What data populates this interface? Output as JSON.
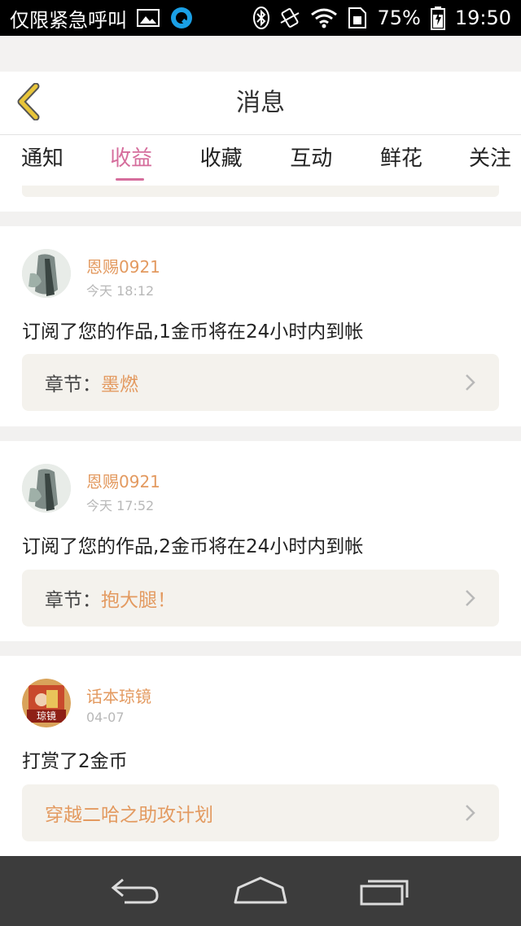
{
  "status_bar": {
    "carrier": "仅限紧急呼叫",
    "battery": "75%",
    "time": "19:50",
    "icons": [
      "image-icon",
      "qq-icon",
      "bluetooth-icon",
      "vibrate-icon",
      "wifi-icon",
      "sim-icon",
      "battery-icon"
    ]
  },
  "header": {
    "title": "消息",
    "back_icon": "chevron-left-icon"
  },
  "tabs": [
    {
      "label": "通知"
    },
    {
      "label": "收益",
      "active": true
    },
    {
      "label": "收藏"
    },
    {
      "label": "互动"
    },
    {
      "label": "鲜花"
    },
    {
      "label": "关注"
    }
  ],
  "messages": [
    {
      "username": "恩赐0921",
      "time": "今天 18:12",
      "text": "订阅了您的作品,1金币将在24小时内到帐",
      "ref_label": "章节：",
      "ref_title": "墨燃"
    },
    {
      "username": "恩赐0921",
      "time": "今天 17:52",
      "text": "订阅了您的作品,2金币将在24小时内到帐",
      "ref_label": "章节：",
      "ref_title": "抱大腿！"
    },
    {
      "username": "话本琼镜",
      "time": "04-07",
      "text": "打赏了2金币",
      "ref_label": "",
      "ref_title": "穿越二哈之助攻计划"
    }
  ],
  "avatar_badge": "琼镜",
  "navbar": {
    "icons": [
      "back-nav-icon",
      "home-nav-icon",
      "recents-nav-icon"
    ]
  },
  "colors": {
    "accent_pink": "#d56d9c",
    "accent_orange": "#e39a60",
    "back_chevron": "#e8c53a",
    "ref_bg": "#f4f2ed"
  }
}
